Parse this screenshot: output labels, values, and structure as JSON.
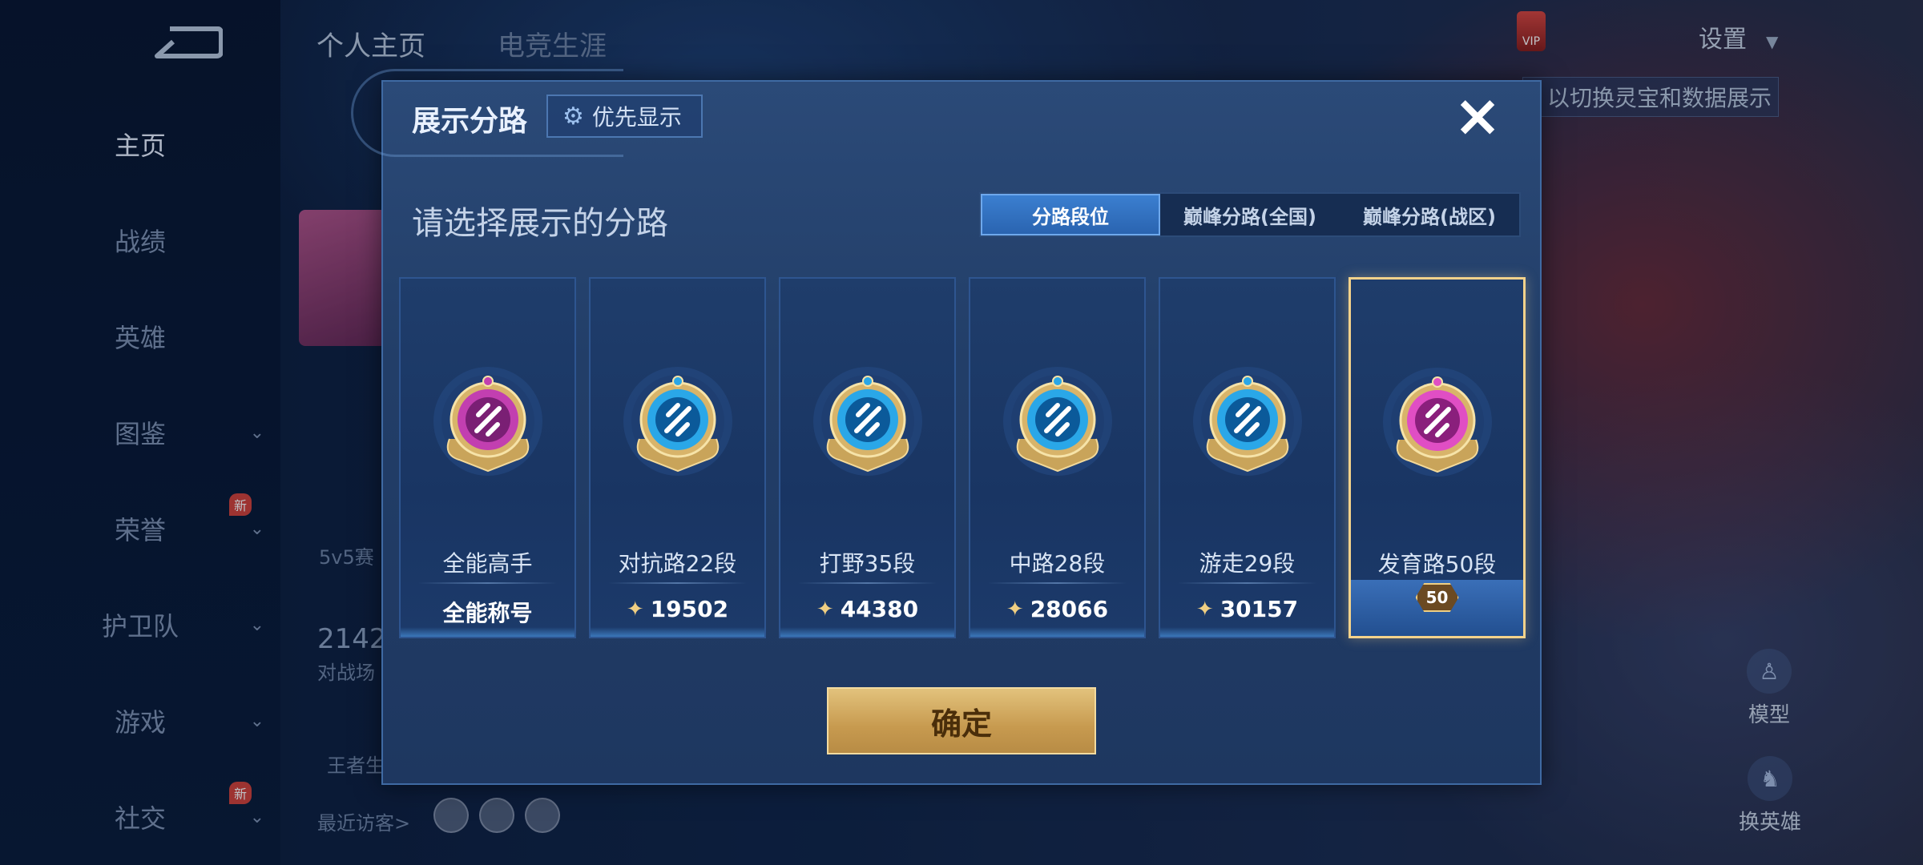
{
  "nav": {
    "items": [
      {
        "label": "主页",
        "active": true,
        "chevron": false,
        "new": false
      },
      {
        "label": "战绩",
        "active": false,
        "chevron": false,
        "new": false
      },
      {
        "label": "英雄",
        "active": false,
        "chevron": false,
        "new": false
      },
      {
        "label": "图鉴",
        "active": false,
        "chevron": true,
        "new": false
      },
      {
        "label": "荣誉",
        "active": false,
        "chevron": true,
        "new": true
      },
      {
        "label": "护卫队",
        "active": false,
        "chevron": true,
        "new": false
      },
      {
        "label": "游戏",
        "active": false,
        "chevron": true,
        "new": false
      },
      {
        "label": "社交",
        "active": false,
        "chevron": true,
        "new": true
      }
    ],
    "new_tag": "新"
  },
  "header": {
    "tabs": [
      "个人主页",
      "电竞生涯"
    ],
    "settings_label": "设置",
    "vip_label": "VIP"
  },
  "background_text": {
    "hint": "以切换灵宝和数据展示",
    "mode_label": "5v5赛",
    "score": "2142",
    "score_sub": "对战场",
    "glory": "王者生",
    "recent_visitors": "最近访客>",
    "model_label": "模型",
    "change_hero_label": "换英雄"
  },
  "modal": {
    "title": "展示分路",
    "priority_button": "优先显示",
    "close_icon": "close-icon",
    "subtitle": "请选择展示的分路",
    "tabs": [
      {
        "label": "分路段位",
        "active": true
      },
      {
        "label": "巅峰分路(全国)",
        "active": false
      },
      {
        "label": "巅峰分路(战区)",
        "active": false
      }
    ],
    "cards": [
      {
        "name": "全能高手",
        "value": "全能称号",
        "points": false,
        "color": "#c23fb0",
        "inner": "#7a1f74",
        "icon": "allrounder-icon",
        "selected": false
      },
      {
        "name": "对抗路22段",
        "value": "19502",
        "points": true,
        "color": "#2aa7e8",
        "inner": "#0b5a9a",
        "icon": "clash-lane-icon",
        "selected": false
      },
      {
        "name": "打野35段",
        "value": "44380",
        "points": true,
        "color": "#2aa7e8",
        "inner": "#0b5a9a",
        "icon": "jungle-icon",
        "selected": false
      },
      {
        "name": "中路28段",
        "value": "28066",
        "points": true,
        "color": "#2aa7e8",
        "inner": "#0b5a9a",
        "icon": "mid-lane-icon",
        "selected": false
      },
      {
        "name": "游走29段",
        "value": "30157",
        "points": true,
        "color": "#2aa7e8",
        "inner": "#0b5a9a",
        "icon": "roam-icon",
        "selected": false
      },
      {
        "name": "发育路50段",
        "value": "",
        "points": false,
        "color": "#e04ec4",
        "inner": "#8a1f7c",
        "icon": "farm-lane-icon",
        "selected": true,
        "level": "50"
      }
    ],
    "confirm_button": "确定"
  }
}
